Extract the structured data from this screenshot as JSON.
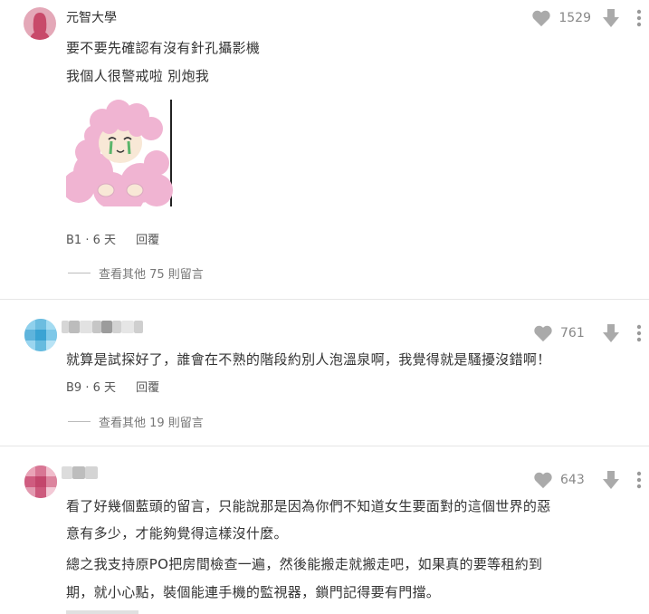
{
  "comments": [
    {
      "author": "元智大學",
      "lines": [
        "要不要先確認有沒有針孔攝影機",
        "我個人很警戒啦 別炮我"
      ],
      "floor": "B1",
      "time": "6 天",
      "reply_label": "回覆",
      "likes": "1529",
      "view_more": "查看其他 75 則留言",
      "avatar_icon": "female-avatar-icon",
      "sticker_icon": "crying-pink-sheep-sticker"
    },
    {
      "author": "",
      "lines": [
        "就算是試探好了，誰會在不熟的階段約別人泡溫泉啊，我覺得就是騷擾沒錯啊！"
      ],
      "floor": "B9",
      "time": "6 天",
      "reply_label": "回覆",
      "likes": "761",
      "view_more": "查看其他 19 則留言"
    },
    {
      "author": "",
      "lines": [
        "看了好幾個藍頭的留言，只能說那是因為你們不知道女生要面對的這個世界的惡",
        "意有多少，才能夠覺得這樣沒什麼。",
        "總之我支持原PO把房間檢查一遍，然後能搬走就搬走吧，如果真的要等租約到",
        "期，就小心點，裝個能連手機的監視器，鎖門記得要有門擋。"
      ],
      "likes": "643"
    }
  ],
  "colors": {
    "avatar_pink": "#e4a8b8",
    "icon_gray": "#aaaaaa",
    "sticker_pink": "#f0b4d2"
  }
}
